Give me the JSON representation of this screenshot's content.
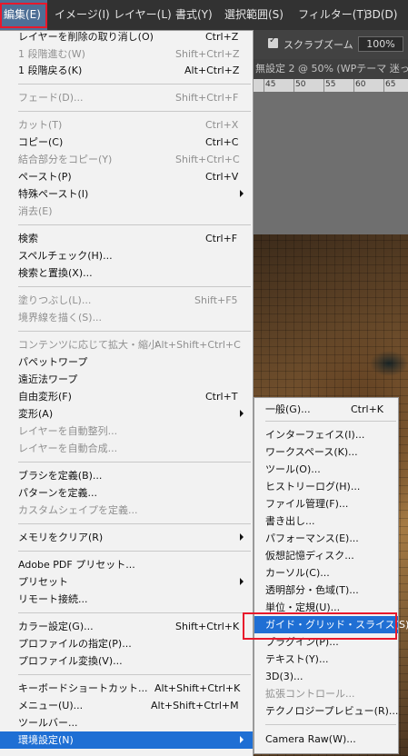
{
  "menubar": {
    "items": [
      "編集(E)",
      "イメージ(I)",
      "レイヤー(L)",
      "書式(Y)",
      "選択範囲(S)",
      "フィルター(T)",
      "3D(D)"
    ]
  },
  "options_bar": {
    "scrubby_zoom_label": "スクラブズーム",
    "scrubby_zoom_checked": true,
    "zoom_value": "100%"
  },
  "document": {
    "tab_title": "無設定 2 @ 50% (WPテーマ 迷っ",
    "ruler_numbers": [
      "45",
      "50",
      "55",
      "60",
      "65"
    ]
  },
  "edit_menu": {
    "items": [
      {
        "label": "レイヤーを削除の取り消し(O)",
        "shortcut": "Ctrl+Z",
        "enabled": true
      },
      {
        "label": "1 段階進む(W)",
        "shortcut": "Shift+Ctrl+Z",
        "enabled": false
      },
      {
        "label": "1 段階戻る(K)",
        "shortcut": "Alt+Ctrl+Z",
        "enabled": true
      },
      {
        "label": "フェード(D)...",
        "shortcut": "Shift+Ctrl+F",
        "enabled": false
      },
      {
        "label": "カット(T)",
        "shortcut": "Ctrl+X",
        "enabled": false
      },
      {
        "label": "コピー(C)",
        "shortcut": "Ctrl+C",
        "enabled": true
      },
      {
        "label": "結合部分をコピー(Y)",
        "shortcut": "Shift+Ctrl+C",
        "enabled": false
      },
      {
        "label": "ペースト(P)",
        "shortcut": "Ctrl+V",
        "enabled": true
      },
      {
        "label": "特殊ペースト(I)",
        "shortcut": "",
        "enabled": true,
        "submenu": true
      },
      {
        "label": "消去(E)",
        "shortcut": "",
        "enabled": false
      },
      {
        "label": "検索",
        "shortcut": "Ctrl+F",
        "enabled": true
      },
      {
        "label": "スペルチェック(H)...",
        "shortcut": "",
        "enabled": true
      },
      {
        "label": "検索と置換(X)...",
        "shortcut": "",
        "enabled": true
      },
      {
        "label": "塗りつぶし(L)...",
        "shortcut": "Shift+F5",
        "enabled": false
      },
      {
        "label": "境界線を描く(S)...",
        "shortcut": "",
        "enabled": false
      },
      {
        "label": "コンテンツに応じて拡大・縮小",
        "shortcut": "Alt+Shift+Ctrl+C",
        "enabled": false
      },
      {
        "label": "パペットワープ",
        "shortcut": "",
        "enabled": true
      },
      {
        "label": "遠近法ワープ",
        "shortcut": "",
        "enabled": true
      },
      {
        "label": "自由変形(F)",
        "shortcut": "Ctrl+T",
        "enabled": true
      },
      {
        "label": "変形(A)",
        "shortcut": "",
        "enabled": true,
        "submenu": true
      },
      {
        "label": "レイヤーを自動整列...",
        "shortcut": "",
        "enabled": false
      },
      {
        "label": "レイヤーを自動合成...",
        "shortcut": "",
        "enabled": false
      },
      {
        "label": "ブラシを定義(B)...",
        "shortcut": "",
        "enabled": true
      },
      {
        "label": "パターンを定義...",
        "shortcut": "",
        "enabled": true
      },
      {
        "label": "カスタムシェイプを定義...",
        "shortcut": "",
        "enabled": false
      },
      {
        "label": "メモリをクリア(R)",
        "shortcut": "",
        "enabled": true,
        "submenu": true
      },
      {
        "label": "Adobe PDF プリセット...",
        "shortcut": "",
        "enabled": true
      },
      {
        "label": "プリセット",
        "shortcut": "",
        "enabled": true,
        "submenu": true
      },
      {
        "label": "リモート接続...",
        "shortcut": "",
        "enabled": true
      },
      {
        "label": "カラー設定(G)...",
        "shortcut": "Shift+Ctrl+K",
        "enabled": true
      },
      {
        "label": "プロファイルの指定(P)...",
        "shortcut": "",
        "enabled": true
      },
      {
        "label": "プロファイル変換(V)...",
        "shortcut": "",
        "enabled": true
      },
      {
        "label": "キーボードショートカット...",
        "shortcut": "Alt+Shift+Ctrl+K",
        "enabled": true
      },
      {
        "label": "メニュー(U)...",
        "shortcut": "Alt+Shift+Ctrl+M",
        "enabled": true
      },
      {
        "label": "ツールバー...",
        "shortcut": "",
        "enabled": true
      },
      {
        "label": "環境設定(N)",
        "shortcut": "",
        "enabled": true,
        "submenu": true,
        "highlighted": true
      }
    ]
  },
  "preferences_submenu": {
    "items": [
      {
        "label": "一般(G)...",
        "shortcut": "Ctrl+K",
        "enabled": true
      },
      {
        "label": "インターフェイス(I)...",
        "shortcut": "",
        "enabled": true
      },
      {
        "label": "ワークスペース(K)...",
        "shortcut": "",
        "enabled": true
      },
      {
        "label": "ツール(O)...",
        "shortcut": "",
        "enabled": true
      },
      {
        "label": "ヒストリーログ(H)...",
        "shortcut": "",
        "enabled": true
      },
      {
        "label": "ファイル管理(F)...",
        "shortcut": "",
        "enabled": true
      },
      {
        "label": "書き出し...",
        "shortcut": "",
        "enabled": true
      },
      {
        "label": "パフォーマンス(E)...",
        "shortcut": "",
        "enabled": true
      },
      {
        "label": "仮想記憶ディスク...",
        "shortcut": "",
        "enabled": true
      },
      {
        "label": "カーソル(C)...",
        "shortcut": "",
        "enabled": true
      },
      {
        "label": "透明部分・色域(T)...",
        "shortcut": "",
        "enabled": true
      },
      {
        "label": "単位・定規(U)...",
        "shortcut": "",
        "enabled": true
      },
      {
        "label": "ガイド・グリッド・スライス(S)...",
        "shortcut": "",
        "enabled": true,
        "highlighted": true
      },
      {
        "label": "プラグイン(P)...",
        "shortcut": "",
        "enabled": true
      },
      {
        "label": "テキスト(Y)...",
        "shortcut": "",
        "enabled": true
      },
      {
        "label": "3D(3)...",
        "shortcut": "",
        "enabled": true
      },
      {
        "label": "拡張コントロール...",
        "shortcut": "",
        "enabled": false
      },
      {
        "label": "テクノロジープレビュー(R)...",
        "shortcut": "",
        "enabled": true
      },
      {
        "label": "Camera Raw(W)...",
        "shortcut": "",
        "enabled": true
      }
    ]
  },
  "colors": {
    "highlight": "#1f6fd4",
    "callout_border": "#e8192c",
    "menubar_bg": "#323232",
    "menu_bg": "#f2f2f2"
  }
}
